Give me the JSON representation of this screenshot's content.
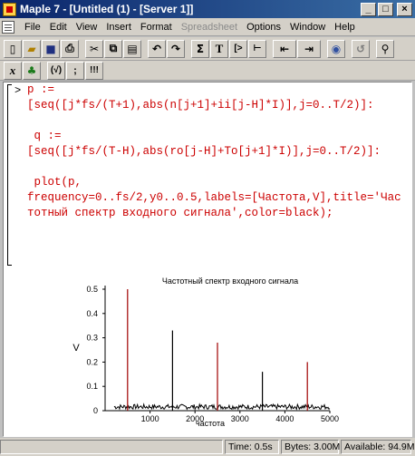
{
  "window": {
    "title": "Maple 7 - [Untitled (1) - [Server 1]]",
    "min_symbol": "_",
    "max_symbol": "□",
    "close_symbol": "×"
  },
  "menu": {
    "items": [
      "File",
      "Edit",
      "View",
      "Insert",
      "Format",
      "Spreadsheet",
      "Options",
      "Window",
      "Help"
    ],
    "disabled_index": 5
  },
  "toolbar1": {
    "buttons": [
      "new-doc",
      "open",
      "save",
      "print",
      "cut",
      "copy",
      "paste",
      "undo",
      "redo",
      "sum",
      "T",
      "[>",
      "|<-",
      "",
      "stop",
      "",
      "zoom"
    ],
    "sum_label": "Σ",
    "text_label": "T",
    "prompt_label": "[>"
  },
  "toolbar2": {
    "x_label": "x",
    "func_label": "(√)",
    "semicolon_label": ";",
    "exclaim_label": "!!!"
  },
  "worksheet": {
    "prompt": ">",
    "code": "p :=\n[seq([j*fs/(T+1),abs(n[j+1]+ii[j-H]*I)],j=0..T/2)]:\n\n q :=\n[seq([j*fs/(T-H),abs(ro[j-H]+To[j+1]*I)],j=0..T/2)]:\n\n plot(p,\nfrequency=0..fs/2,y0..0.5,labels=[Частота,V],title='Частотный спектр входного сигнала',color=black);"
  },
  "chart_data": {
    "type": "line",
    "title": "Частотный спектр входного сигнала",
    "xlabel": "частота",
    "ylabel": "V",
    "xlim": [
      0,
      5000
    ],
    "ylim": [
      0,
      0.5
    ],
    "x_ticks": [
      "1000",
      "2000",
      "3000",
      "4000",
      "5000"
    ],
    "y_ticks": [
      "0",
      "0.1",
      "0.2",
      "0.3",
      "0.4",
      "0.5"
    ],
    "peaks": [
      {
        "x": 500,
        "y": 0.5
      },
      {
        "x": 1500,
        "y": 0.33
      },
      {
        "x": 2500,
        "y": 0.28
      },
      {
        "x": 3500,
        "y": 0.16
      },
      {
        "x": 4500,
        "y": 0.2
      }
    ],
    "noise_level": 0.02,
    "grid": false,
    "color": "#000000"
  },
  "status": {
    "time": "Time:  0.5s",
    "bytes": "Bytes: 3.00M",
    "available": "Available: 94.9M"
  }
}
